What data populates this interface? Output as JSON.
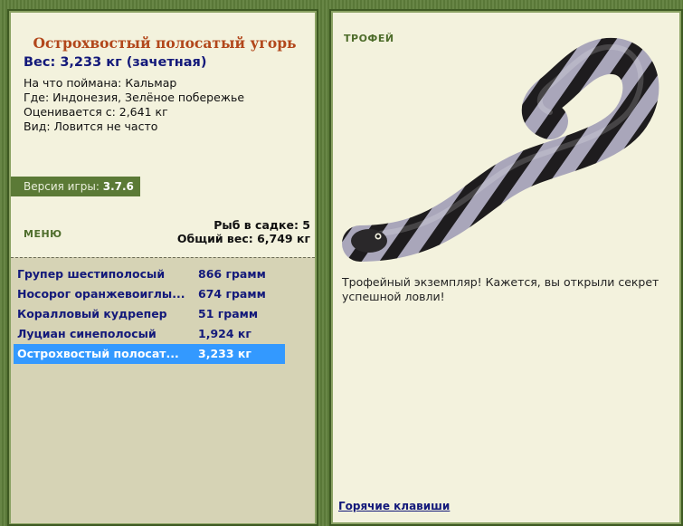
{
  "fish_details": {
    "title": "Острохвостый полосатый угорь",
    "weight": "Вес: 3,233 кг (зачетная)",
    "bait": "На что поймана: Кальмар",
    "location": "Где: Индонезия, Зелёное побережье",
    "valued_from": "Оценивается с: 2,641 кг",
    "rarity": "Вид: Ловится не часто"
  },
  "version": {
    "label": "Версия игры:",
    "value": "3.7.6"
  },
  "menu": {
    "label": "МЕНЮ"
  },
  "keepnet": {
    "count_text": "Рыб в садке: 5",
    "total_text": "Общий вес: 6,749 кг"
  },
  "catch_list": [
    {
      "name": "Групер шестиполосый",
      "weight": "866 грамм"
    },
    {
      "name": "Носорог оранжевоиглы...",
      "weight": "674 грамм"
    },
    {
      "name": "Коралловый кудрепер",
      "weight": "51 грамм"
    },
    {
      "name": "Луциан синеполосый",
      "weight": "1,924 кг"
    },
    {
      "name": "Острохвостый полосат...",
      "weight": "3,233 кг"
    }
  ],
  "selected_index": 4,
  "trophy": {
    "label": "ТРОФЕЙ",
    "message": "Трофейный экземпляр! Кажется, вы открыли секрет успешной ловли!"
  },
  "hotkeys_link": "Горячие клавиши",
  "colors": {
    "title": "#b2471b",
    "link": "#13197a",
    "selection": "#3399ff",
    "frame": "#5f7f3b"
  }
}
